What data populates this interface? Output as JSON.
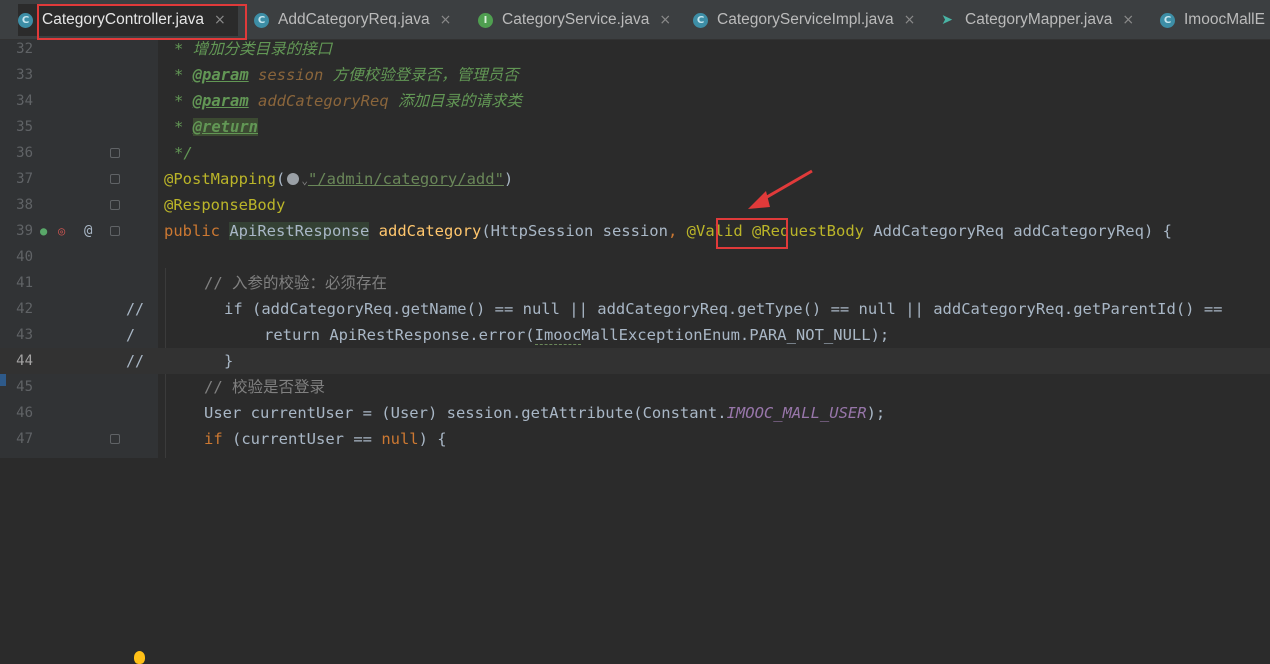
{
  "tabs": [
    {
      "label": "CategoryController.java",
      "icon": "class-c-icon",
      "active": true
    },
    {
      "label": "AddCategoryReq.java",
      "icon": "class-c-icon"
    },
    {
      "label": "CategoryService.java",
      "icon": "interface-i-icon"
    },
    {
      "label": "CategoryServiceImpl.java",
      "icon": "class-c-icon"
    },
    {
      "label": "CategoryMapper.java",
      "icon": "mapper-bird-icon"
    },
    {
      "label": "ImoocMallE",
      "icon": "class-c-icon"
    }
  ],
  "tab_close_glyph": "×",
  "line_numbers": [
    "32",
    "33",
    "34",
    "35",
    "36",
    "37",
    "38",
    "39",
    "40",
    "41",
    "42",
    "43",
    "44",
    "45",
    "46",
    "47"
  ],
  "current_line": "44",
  "code": {
    "l32": {
      "star": "*",
      "text": " 增加分类目录的接口"
    },
    "l33": {
      "star": "* ",
      "tag": "@param",
      "param": "session",
      "text": " 方便校验登录否，管理员否"
    },
    "l34": {
      "star": "* ",
      "tag": "@param",
      "param": "addCategoryReq",
      "text": " 添加目录的请求类"
    },
    "l35": {
      "star": "* ",
      "tag": "@return"
    },
    "l36": {
      "end": "*/"
    },
    "l37": {
      "ann": "@PostMapping",
      "open": "(",
      "url": "\"/admin/category/add\"",
      "close": ")"
    },
    "l38": {
      "ann": "@ResponseBody"
    },
    "l39": {
      "kw": "public",
      "type": "ApiRestResponse",
      "fn": "addCategory",
      "params1": "(HttpSession session",
      "comma": ",",
      "valid": "@Valid",
      "reqbody": "@RequestBody",
      "params2": "AddCategoryReq addCategoryReq) {"
    },
    "l41": {
      "comment": "// 入参的校验：必须存在"
    },
    "l42": {
      "slash": "//",
      "text": "if (addCategoryReq.getName() == null || addCategoryReq.getType() == null || addCategoryReq.getParentId() =="
    },
    "l43": {
      "slash": "/",
      "pre": "return ApiRestResponse.error(",
      "ul": "Imooc",
      "post": "MallExceptionEnum.PARA_NOT_NULL);"
    },
    "l44": {
      "slash": "//",
      "text": "}"
    },
    "l45": {
      "comment": "// 校验是否登录"
    },
    "l46": {
      "pre": "User currentUser = (User) session.getAttribute(Constant.",
      "static": "IMOOC_MALL_USER",
      "post": ");"
    },
    "l47": {
      "kw": "if",
      "mid": " (currentUser == ",
      "null": "null",
      "post": ") {"
    }
  },
  "gutter_at": "@",
  "colors": {
    "highlight_red": "#e03a3a",
    "background": "#2b2b2b",
    "annotation": "#bbb529",
    "keyword": "#cc7832"
  }
}
